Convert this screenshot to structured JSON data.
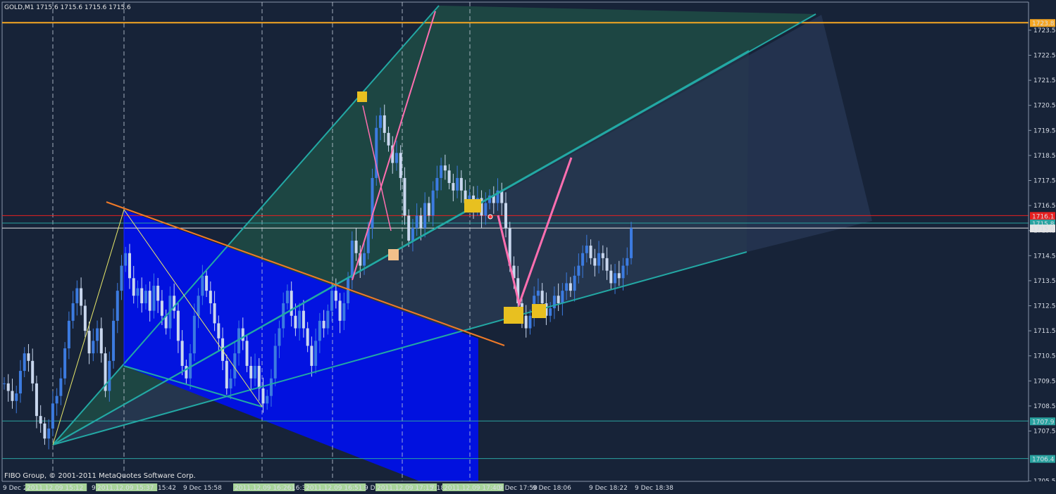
{
  "chart_header": "GOLD,M1  1715.6 1715.6 1715.6 1715.6",
  "copyright": "FIBO Group, © 2001-2011 MetaQuotes Software Corp.",
  "colors": {
    "background": "#172338",
    "bull": "#3c7be0",
    "bear": "#c9d7ee",
    "fan_fill": "#1e4a45",
    "fan_line": "#23a8a4",
    "channel_fill": "#0010ee",
    "trend_orange": "#f07a28",
    "pink": "#ff6fb0",
    "marker_yellow": "#e8c020",
    "marker_peach": "#f2c08a",
    "axis_text": "#d8dde6"
  },
  "chart_data": {
    "type": "candlestick",
    "symbol": "GOLD",
    "timeframe": "M1",
    "ylim": [
      1705.0,
      1724.0
    ],
    "price_ticks": [
      "1723.5",
      "1722.5",
      "1721.5",
      "1720.5",
      "1719.5",
      "1718.5",
      "1717.5",
      "1716.5",
      "1715.5",
      "1714.5",
      "1713.5",
      "1712.5",
      "1711.5",
      "1710.5",
      "1709.5",
      "1708.5",
      "1707.5",
      "1705.5"
    ],
    "price_tick_values": [
      1723.5,
      1722.5,
      1721.5,
      1720.5,
      1719.5,
      1718.5,
      1717.5,
      1716.5,
      1715.5,
      1714.5,
      1713.5,
      1712.5,
      1711.5,
      1710.5,
      1709.5,
      1708.5,
      1707.5,
      1705.5
    ],
    "time_labels": [
      "9 Dec 2011",
      "2011.12.09 15:12",
      "9 De",
      "2011.12.09 15:37",
      "15:42",
      "9 Dec 15:58",
      "2011.12.09 16:26",
      "16:3",
      "2011.12.09 16:51",
      "9 De",
      "2011.12.09 17:15",
      "7:18",
      "2011.12.09 17:40",
      "9 Dec 17:50",
      "9 Dec 18:06",
      "9 Dec 18:22",
      "9 Dec 18:38"
    ],
    "highlighted_time_labels": [
      false,
      true,
      false,
      true,
      false,
      false,
      true,
      false,
      true,
      false,
      true,
      false,
      true,
      false,
      false,
      false,
      false
    ],
    "price_levels": [
      {
        "label": "1723.8",
        "value": 1723.8,
        "color": "#f5a623"
      },
      {
        "label": "1716.1",
        "value": 1716.1,
        "color": "#e82020"
      },
      {
        "label": "1715.8",
        "value": 1715.8,
        "color": "#2aa3a0"
      },
      {
        "label": "1715.6",
        "value": 1715.6,
        "color": "#e6e6e6"
      },
      {
        "label": "1707.9",
        "value": 1707.9,
        "color": "#2aa3a0"
      },
      {
        "label": "1706.4",
        "value": 1706.4,
        "color": "#2aa3a0"
      }
    ],
    "close_path": [
      1709.4,
      1709.1,
      1708.7,
      1709.0,
      1709.9,
      1710.6,
      1710.3,
      1709.4,
      1708.1,
      1707.8,
      1707.2,
      1707.6,
      1708.6,
      1708.9,
      1709.6,
      1710.8,
      1711.9,
      1712.6,
      1713.2,
      1712.5,
      1711.5,
      1710.6,
      1711.1,
      1711.6,
      1710.6,
      1709.1,
      1710.3,
      1711.9,
      1713.1,
      1714.1,
      1714.6,
      1713.6,
      1712.9,
      1713.2,
      1712.6,
      1713.1,
      1712.3,
      1713.3,
      1712.7,
      1712.1,
      1711.6,
      1712.9,
      1712.3,
      1711.1,
      1710.1,
      1709.6,
      1710.6,
      1712.1,
      1712.9,
      1713.7,
      1713.1,
      1712.6,
      1711.8,
      1711.2,
      1710.3,
      1709.2,
      1709.6,
      1710.6,
      1711.6,
      1711.1,
      1710.1,
      1709.6,
      1710.1,
      1709.2,
      1708.6,
      1708.9,
      1709.6,
      1710.9,
      1711.6,
      1712.6,
      1713.1,
      1712.1,
      1711.6,
      1712.3,
      1711.6,
      1710.9,
      1710.1,
      1711.1,
      1711.9,
      1711.6,
      1712.3,
      1713.1,
      1712.7,
      1711.9,
      1712.6,
      1713.6,
      1715.1,
      1714.6,
      1714.1,
      1714.6,
      1715.6,
      1717.6,
      1719.6,
      1720.1,
      1719.4,
      1718.9,
      1718.2,
      1718.6,
      1717.6,
      1716.1,
      1715.1,
      1715.6,
      1716.1,
      1715.6,
      1716.6,
      1716.1,
      1717.1,
      1717.6,
      1718.1,
      1717.9,
      1717.4,
      1717.1,
      1717.6,
      1717.1,
      1716.6,
      1716.9,
      1716.4,
      1716.8,
      1716.1,
      1716.6,
      1716.9,
      1716.6,
      1717.1,
      1716.6,
      1715.6,
      1714.1,
      1713.6,
      1712.6,
      1712.1,
      1711.6,
      1712.1,
      1712.9,
      1713.1,
      1712.6,
      1712.1,
      1712.4,
      1712.9,
      1712.6,
      1713.1,
      1713.4,
      1713.1,
      1713.7,
      1714.1,
      1714.6,
      1714.9,
      1714.4,
      1714.1,
      1714.6,
      1714.4,
      1713.9,
      1713.4,
      1713.8,
      1713.6,
      1714.1,
      1714.4,
      1715.6
    ]
  }
}
